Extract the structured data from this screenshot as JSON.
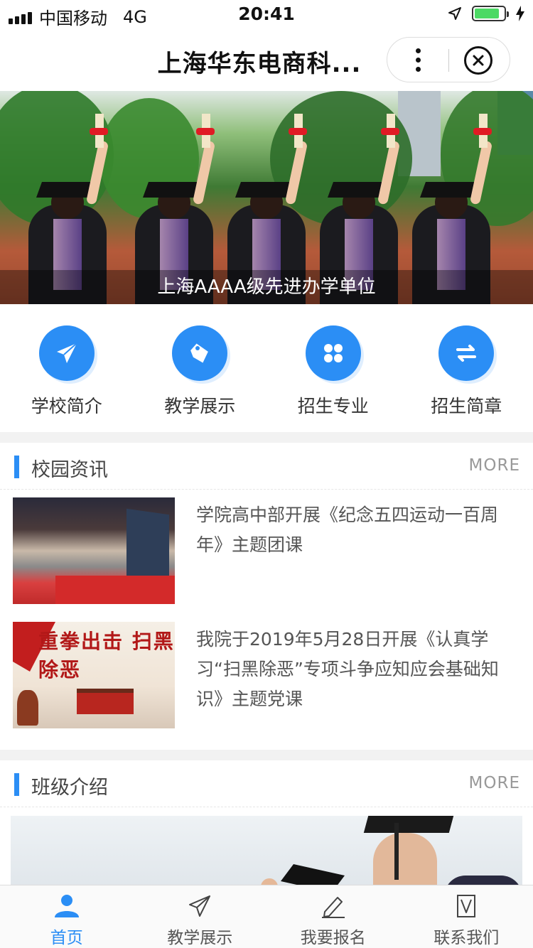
{
  "status_bar": {
    "carrier": "中国移动",
    "network": "4G",
    "time": "20:41",
    "battery_level": 0.85
  },
  "nav": {
    "title": "上海华东电商科..."
  },
  "banner": {
    "caption": "上海AAAA级先进办学单位"
  },
  "quick_menu": [
    {
      "label": "学校简介",
      "icon": "paper-plane-icon"
    },
    {
      "label": "教学展示",
      "icon": "tag-icon"
    },
    {
      "label": "招生专业",
      "icon": "grid-icon"
    },
    {
      "label": "招生简章",
      "icon": "swap-icon"
    }
  ],
  "news": {
    "title": "校园资讯",
    "more": "MORE",
    "items": [
      {
        "title": "学院高中部开展《纪念五四运动一百周年》主题团课"
      },
      {
        "title": "我院于2019年5月28日开展《认真学习“扫黑除恶”专项斗争应知应会基础知识》主题党课",
        "thumb_text": "重拳出击 扫黑除恶"
      }
    ]
  },
  "classes": {
    "title": "班级介绍",
    "more": "MORE"
  },
  "tabbar": [
    {
      "label": "首页",
      "icon": "user-icon",
      "active": true
    },
    {
      "label": "教学展示",
      "icon": "paper-plane-outline-icon",
      "active": false
    },
    {
      "label": "我要报名",
      "icon": "pencil-icon",
      "active": false
    },
    {
      "label": "联系我们",
      "icon": "bookmark-v-icon",
      "active": false
    }
  ],
  "colors": {
    "accent": "#2b8ef5",
    "battery": "#4cd964"
  }
}
